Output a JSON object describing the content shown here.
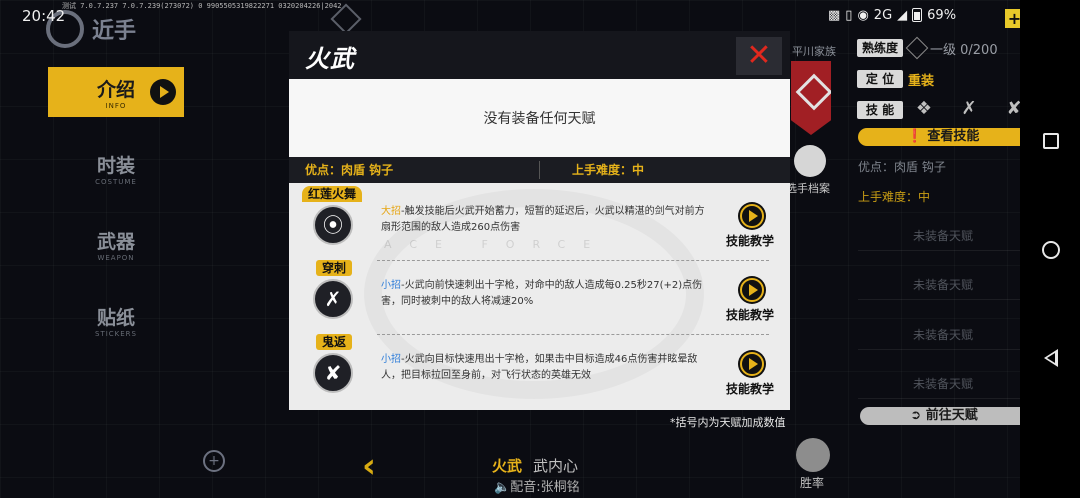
{
  "status_bar": {
    "time": "20:42",
    "debug": "测试 7.0.7.237 7.0.7.239(273072) 0 9905505319822271 0320204226|2042",
    "network": "2G",
    "battery": "69%",
    "plus": "+"
  },
  "logo": {
    "text": "近手"
  },
  "nav": [
    {
      "cn": "介绍",
      "en": "INFO",
      "active": true
    },
    {
      "cn": "时装",
      "en": "COSTUME"
    },
    {
      "cn": "武器",
      "en": "WEAPON"
    },
    {
      "cn": "贴纸",
      "en": "STICKERS"
    }
  ],
  "bottom": {
    "char_name": "火武",
    "char_sub": "武内心",
    "voice": "配音:张桐铭",
    "winrate": "胜率"
  },
  "right_panel": {
    "family": "平川家族",
    "proficiency_tag": "熟练度",
    "proficiency_value": "一级 0/200",
    "position_tag": "定 位",
    "position_value": "重装",
    "skills_tag": "技 能",
    "check_skill": "查看技能",
    "advantage": "优点：肉盾 钩子",
    "difficulty": "上手难度：中",
    "profile": "选手档案",
    "slots": [
      "未装备天赋",
      "未装备天赋",
      "未装备天赋",
      "未装备天赋"
    ],
    "go_talent": "前往天赋"
  },
  "dialog": {
    "title": "火武",
    "close": "✕",
    "no_talent": "没有装备任何天赋",
    "advantage": "优点：肉盾  钩子",
    "difficulty": "上手难度：中",
    "watermark": "ACE FORCE",
    "skills": [
      {
        "tag": "红莲火舞",
        "kind": "大招",
        "text": "-触发技能后火武开始蓄力，短暂的延迟后，火武以精湛的剑气对前方扇形范围的敌人造成260点伤害",
        "teach": "技能教学"
      },
      {
        "tag": "穿刺",
        "kind": "小招",
        "text": "-火武向前快速刺出十字枪，对命中的敌人造成每0.25秒27(+2)点伤害，同时被刺中的敌人将减速20%",
        "teach": "技能教学"
      },
      {
        "tag": "鬼返",
        "kind": "小招",
        "text": "-火武向目标快速甩出十字枪，如果击中目标造成46点伤害并眩晕敌人，把目标拉回至身前，对飞行状态的英雄无效",
        "teach": "技能教学"
      }
    ],
    "footnote": "*括号内为天赋加成数值"
  }
}
